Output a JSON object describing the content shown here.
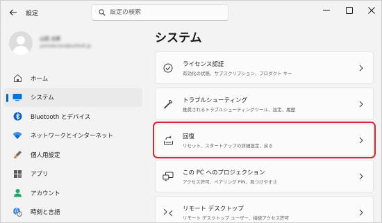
{
  "window": {
    "app_title": "設定",
    "search_placeholder": "設定の検索"
  },
  "profile": {
    "name": "山田 太郎",
    "email": "yamada.taro@outlook.jp"
  },
  "nav": {
    "items": [
      {
        "label": "ホーム",
        "icon": "home-icon"
      },
      {
        "label": "システム",
        "icon": "monitor-icon",
        "active": true
      },
      {
        "label": "Bluetooth とデバイス",
        "icon": "bluetooth-icon"
      },
      {
        "label": "ネットワークとインターネット",
        "icon": "wifi-icon"
      },
      {
        "label": "個人用設定",
        "icon": "paint-brush-icon"
      },
      {
        "label": "アプリ",
        "icon": "apps-icon"
      },
      {
        "label": "アカウント",
        "icon": "account-icon"
      },
      {
        "label": "時刻と言語",
        "icon": "globe-clock-icon"
      }
    ]
  },
  "main": {
    "title": "システム",
    "cards": [
      {
        "title": "ライセンス認証",
        "desc": "有効化の状態、サブスクリプション、プロダクト キー",
        "icon": "check-circle-icon"
      },
      {
        "title": "トラブルシューティング",
        "desc": "推奨されるトラブルシューティングツール、設定、履歴",
        "icon": "wrench-icon"
      },
      {
        "title": "回復",
        "desc": "リセット、スタートアップの詳細設定、戻る",
        "icon": "recovery-icon",
        "highlighted": true
      },
      {
        "title": "この PC へのプロジェクション",
        "desc": "アクセス許可、ペアリング PIN、見つけやすさ",
        "icon": "projection-icon"
      },
      {
        "title": "リモート デスクトップ",
        "desc": "リモート デスクトップ ユーザー、接続アクセス許可",
        "icon": "remote-desktop-icon"
      }
    ]
  },
  "colors": {
    "accent": "#0067c0",
    "highlight": "#e0242f",
    "background": "#f3f3f3",
    "card": "#fbfbfb"
  }
}
